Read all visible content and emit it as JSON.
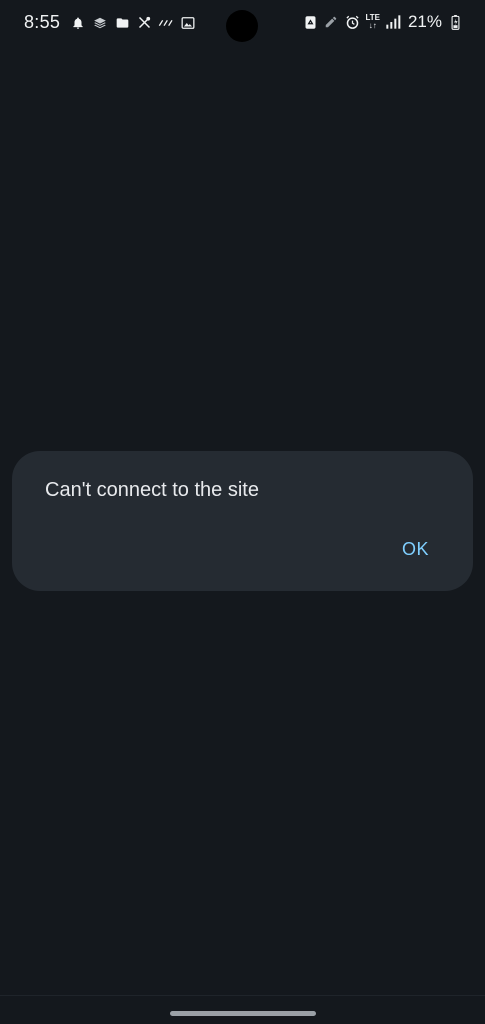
{
  "status_bar": {
    "time": "8:55",
    "left_icons": [
      "notification-bell-icon",
      "layers-icon",
      "folder-icon",
      "tools-icon",
      "link-icon",
      "image-icon"
    ],
    "right_icons": [
      "recycle-icon",
      "edit-icon",
      "alarm-icon",
      "lte-icon",
      "signal-icon",
      "battery-icon"
    ],
    "network_label": "LTE",
    "battery_percent": "21%"
  },
  "dialog": {
    "message": "Can't connect to the site",
    "ok_label": "OK"
  },
  "colors": {
    "background": "#14181d",
    "dialog_background": "#252b32",
    "accent": "#7fcfff"
  }
}
